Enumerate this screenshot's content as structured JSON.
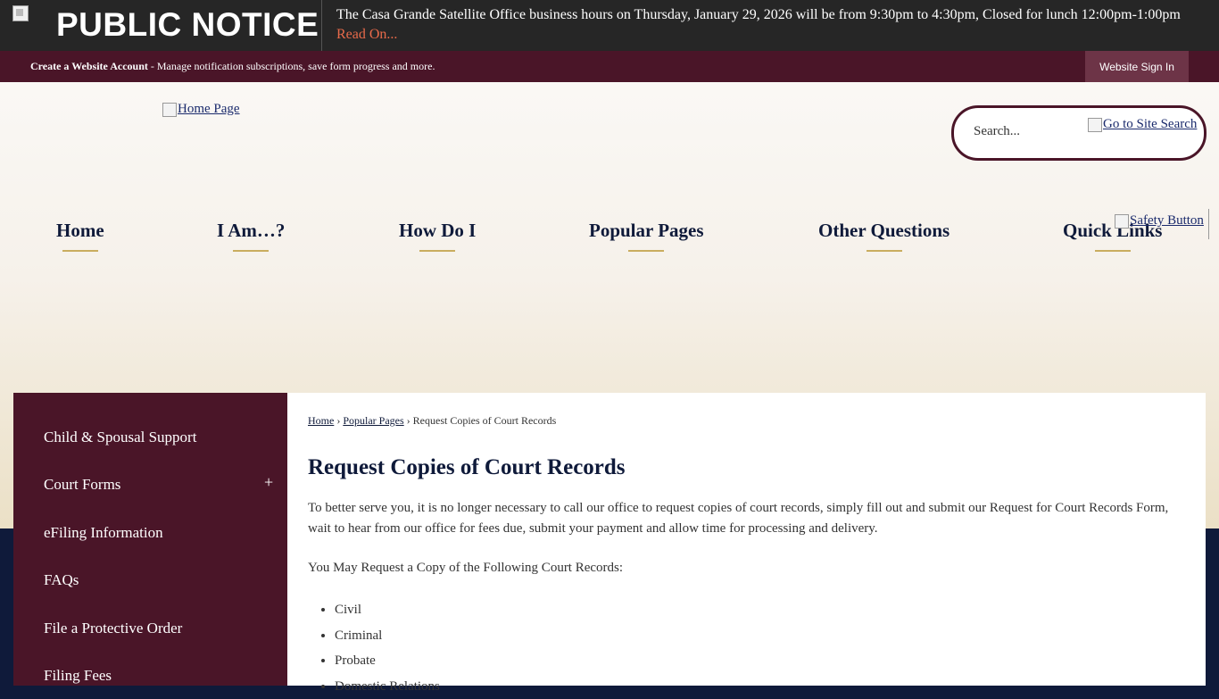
{
  "notice": {
    "title": "PUBLIC NOTICE",
    "text": "The Casa Grande Satellite Office business hours on Thursday, January 29, 2026 will be from 9:30pm to 4:30pm, Closed for lunch 12:00pm-1:00pm",
    "read_on": "Read On..."
  },
  "account_bar": {
    "create_label": "Create a Website Account",
    "description": " - Manage notification subscriptions, save form progress and more.",
    "sign_in": "Website Sign In"
  },
  "header": {
    "home_link_alt": "Home Page",
    "search_placeholder": "Search...",
    "search_button_alt": "Go to Site Search",
    "safety_button_alt": "Safety Button"
  },
  "nav": [
    "Home",
    "I Am…?",
    "How Do I",
    "Popular Pages",
    "Other Questions",
    "Quick Links"
  ],
  "sidebar": [
    "Child & Spousal Support",
    "Court Forms",
    "eFiling Information",
    "FAQs",
    "File a Protective Order",
    "Filing Fees"
  ],
  "sidebar_expand_symbol": "+",
  "breadcrumb": {
    "home": "Home",
    "sep1": "›",
    "section": "Popular Pages",
    "sep2": "›",
    "current": "Request Copies of Court Records"
  },
  "content": {
    "title": "Request Copies of Court Records",
    "intro": "To better serve you, it is no longer necessary to call our office to request copies of court records, simply fill out and submit our Request for Court Records Form, wait to hear from our office for fees due, submit your payment and allow time for processing and delivery.",
    "list_heading": "You May Request a Copy of the Following Court Records:",
    "records": [
      "Civil",
      "Criminal",
      "Probate",
      "Domestic Relations"
    ]
  },
  "colors": {
    "maroon": "#4a1528",
    "navy": "#0f1a3a",
    "gold_underline": "#c9ad5f",
    "read_on": "#e86a4a"
  }
}
